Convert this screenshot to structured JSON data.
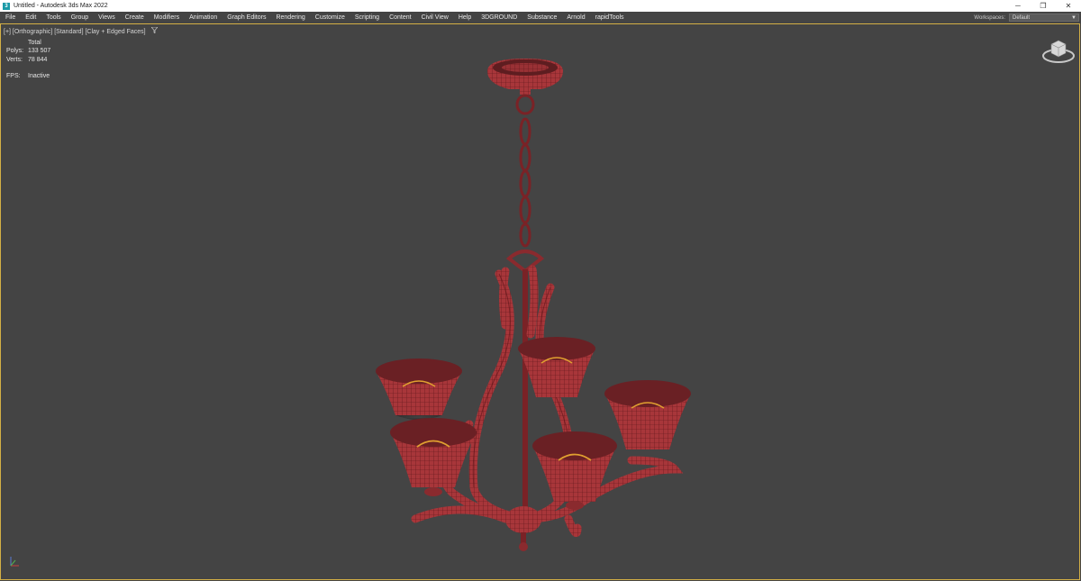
{
  "window": {
    "title": "Untitled - Autodesk 3ds Max 2022",
    "minimize_glyph": "─",
    "restore_glyph": "❐",
    "close_glyph": "✕"
  },
  "menu": [
    "File",
    "Edit",
    "Tools",
    "Group",
    "Views",
    "Create",
    "Modifiers",
    "Animation",
    "Graph Editors",
    "Rendering",
    "Customize",
    "Scripting",
    "Content",
    "Civil View",
    "Help",
    "3DGROUND",
    "Substance",
    "Arnold",
    "rapidTools"
  ],
  "workspaces": {
    "label": "Workspaces:",
    "value": "Default"
  },
  "viewport": {
    "label": "[+] [Orthographic] [Standard] [Clay + Edged Faces]",
    "filter_icon": "funnel-icon",
    "border_color": "#d4b045"
  },
  "stats": {
    "header": "Total",
    "polys_label": "Polys:",
    "polys_value": "133 507",
    "verts_label": "Verts:",
    "verts_value": "78 844",
    "fps_label": "FPS:",
    "fps_value": "Inactive"
  },
  "scene": {
    "object": "chandelier-model",
    "mesh_color": "#a8363a",
    "wire_color": "#5a1418",
    "bulb_color": "#e0a030"
  }
}
